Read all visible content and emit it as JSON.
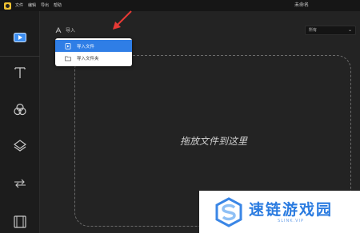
{
  "menu": {
    "items": [
      "文件",
      "编辑",
      "导出",
      "帮助"
    ]
  },
  "window": {
    "title": "未命名"
  },
  "toolbar": {
    "import_label": "导入",
    "filter_value": "所有"
  },
  "import_menu": {
    "items": [
      {
        "label": "导入文件",
        "icon": "file-icon",
        "highlighted": true
      },
      {
        "label": "导入文件夹",
        "icon": "folder-icon",
        "highlighted": false
      }
    ]
  },
  "dropzone": {
    "text": "拖放文件到这里"
  },
  "sidebar": {
    "icons": [
      "media-icon",
      "text-icon",
      "filters-icon",
      "overlays-icon",
      "transitions-icon",
      "elements-icon"
    ]
  },
  "watermark": {
    "main": "速链游戏园",
    "sub": "SLINK.VIP"
  },
  "colors": {
    "accent": "#2f7ee6",
    "logo": "#f1c232",
    "annotation_arrow": "#e53935",
    "watermark": "#2a7be0"
  }
}
